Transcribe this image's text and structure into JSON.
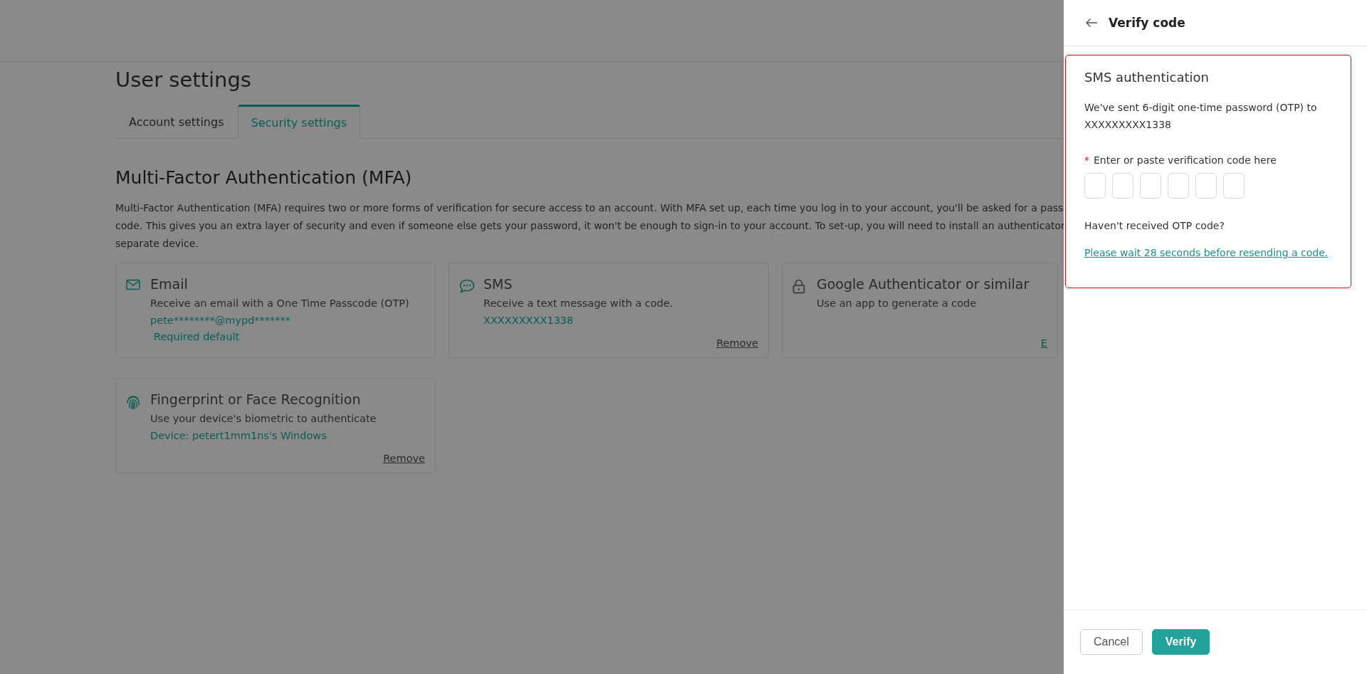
{
  "page": {
    "title": "User settings",
    "tabs": [
      {
        "label": "Account settings",
        "selected": false
      },
      {
        "label": "Security settings",
        "selected": true
      }
    ],
    "section_title": "Multi-Factor Authentication (MFA)",
    "description_lines": [
      "Multi-Factor Authentication (MFA) requires two or more forms of verification for secure access to an account. With MFA set up, each time you log in to your account, you'll be asked for a pass",
      "code. This gives you an extra layer of security and even if someone else gets your password, it won't be enough to sign-in to your account. To set-up, you will need to install an authenticator",
      "separate device."
    ],
    "methods": [
      {
        "kind": "email",
        "title": "Email",
        "description": "Receive an email with a One Time Passcode (OTP)",
        "detail": "pete********@mypd*******",
        "badge": "Required default"
      },
      {
        "kind": "sms",
        "title": "SMS",
        "description": "Receive a text message with a code.",
        "detail": "XXXXXXXXX1338",
        "action": "Remove"
      },
      {
        "kind": "authenticator",
        "title": "Google Authenticator or similar",
        "description": "Use an app to generate a code",
        "action": "E"
      },
      {
        "kind": "fingerprint",
        "title": "Fingerprint or Face Recognition",
        "description": "Use your device's biometric to authenticate",
        "detail": "Device: petert1mm1ns's Windows",
        "action": "Remove"
      }
    ]
  },
  "drawer": {
    "title": "Verify code",
    "card": {
      "title": "SMS authentication",
      "message": "We've sent 6-digit one-time password (OTP) to XXXXXXXXX1338",
      "required_mark": "*",
      "field_label": "Enter or paste verification code here",
      "code_boxes": [
        {
          "focused": false
        },
        {
          "focused": false
        },
        {
          "focused": false
        },
        {
          "focused": false
        },
        {
          "focused": false
        },
        {
          "focused": false
        }
      ],
      "resend_question": "Haven't received OTP code?",
      "resend_link": "Please wait 28 seconds before resending a code."
    },
    "buttons": [
      {
        "label": "Cancel",
        "kind": "secondary"
      },
      {
        "label": "Verify",
        "kind": "primary"
      }
    ]
  }
}
